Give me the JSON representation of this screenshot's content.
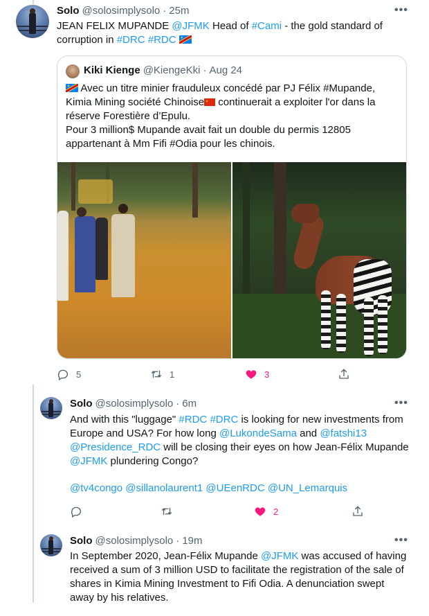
{
  "tweets": [
    {
      "name": "Solo",
      "handle": "@solosimplysolo",
      "dot": "·",
      "time": "25m",
      "more": "•••",
      "text_parts": {
        "p1": "JEAN FELIX MUPANDE ",
        "mention1": "@JFMK",
        "p2": " Head of ",
        "tag1": "#Cami",
        "p3": " - the gold standard of corruption in ",
        "tag2": "#DRC",
        "sp": " ",
        "tag3": "#RDC"
      },
      "quote": {
        "name": "Kiki Kienge",
        "handle": "@KiengeKki",
        "dot": "·",
        "time": "Aug 24",
        "line1": " Avec un titre minier frauduleux concédé par PJ Félix #Mupande, Kimia Mining société Chinoise",
        "line1b": " continuerait a exploiter l'or dans la réserve Forestière d’Epulu.",
        "line2": "Pour 3 million$ Mupande avait fait un double du permis 12805 appartenant à Mm Fifi #Odia pour les chinois."
      },
      "counts": {
        "reply": "5",
        "retweet": "1",
        "like": "3"
      }
    },
    {
      "name": "Solo",
      "handle": "@solosimplysolo",
      "dot": "·",
      "time": "6m",
      "more": "•••",
      "text_parts": {
        "a1": "And with this \"luggage\" ",
        "t1": "#RDC",
        "a2": " ",
        "t2": "#DRC",
        "a3": " is looking for new investments from Europe and USA? For how long  ",
        "m1": "@LukondeSama",
        "a4": " and ",
        "m2": "@fatshi13",
        "a5": " ",
        "m3": "@Presidence_RDC",
        "a6": " will be closing their eyes on how Jean-Félix Mupande ",
        "m4": "@JFMK",
        "a7": " plundering Congo?",
        "m5": "@tv4congo",
        "m6": "@sillanolaurent1",
        "m7": "@UEenRDC",
        "m8": "@UN_Lemarquis"
      },
      "counts": {
        "reply": "",
        "retweet": "",
        "like": "2"
      }
    },
    {
      "name": "Solo",
      "handle": "@solosimplysolo",
      "dot": "·",
      "time": "19m",
      "more": "•••",
      "text_parts": {
        "b1": "In September 2020, Jean-Félix Mupande ",
        "m1": "@JFMK",
        "b2": " was accused of having received a sum of 3 million USD to facilitate the registration of the sale of shares in Kimia Mining Investment to Fifi Odia. A denunciation swept away by his relatives."
      }
    }
  ],
  "colors": {
    "link": "#1d9bf0",
    "like": "#f91880",
    "muted": "#536471"
  }
}
